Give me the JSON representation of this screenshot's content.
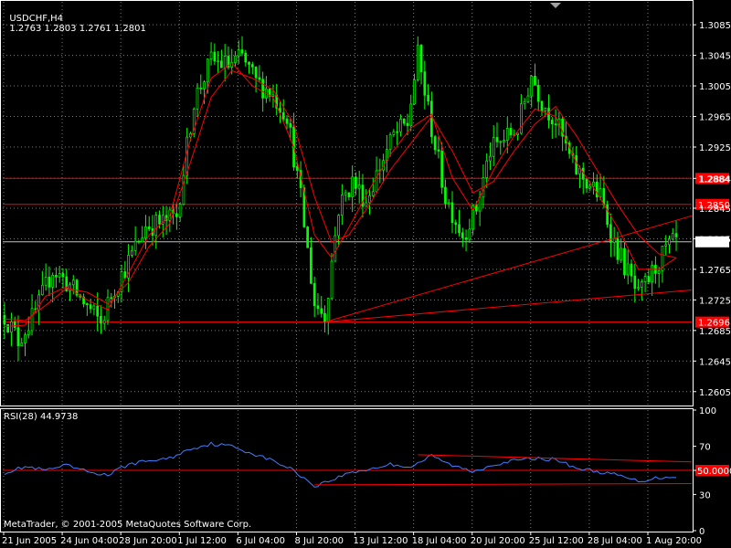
{
  "header": {
    "symbol": "USDCHF,H4",
    "ohlc": "1.2763 1.2803 1.2761 1.2801"
  },
  "rsi_label": "RSI(28) 44.9738",
  "copyright": "MetaTrader, © 2001-2005 MetaQuotes Software Corp.",
  "colors": {
    "background": "#000000",
    "grid": "#808080",
    "candles": "#00ff00",
    "indicator_lines": "#ff0000",
    "rsi": "#3f7fff",
    "text": "#ffffff"
  },
  "chart_data": [
    {
      "type": "candlestick",
      "title": "USDCHF,H4",
      "current_price": 1.2801,
      "ylim": [
        1.2588,
        1.3115
      ],
      "y_ticks": [
        "1.3085",
        "1.3045",
        "1.3005",
        "1.2965",
        "1.2925",
        "1.2884",
        "1.2845",
        "1.2805",
        "1.2765",
        "1.2725",
        "1.2685",
        "1.2645",
        "1.2605"
      ],
      "x_ticks": [
        "21 Jun 2005",
        "24 Jun 04:00",
        "28 Jun 20:00",
        "1 Jul 12:00",
        "6 Jul 04:00",
        "8 Jul 20:00",
        "13 Jul 12:00",
        "18 Jul 04:00",
        "20 Jul 20:00",
        "25 Jul 12:00",
        "28 Jul 04:00",
        "1 Aug 20:00"
      ],
      "price_path": [
        [
          0,
          1.2705
        ],
        [
          4,
          1.2672
        ],
        [
          9,
          1.2708
        ],
        [
          14,
          1.2765
        ],
        [
          18,
          1.2748
        ],
        [
          23,
          1.2722
        ],
        [
          28,
          1.2694
        ],
        [
          31,
          1.2732
        ],
        [
          36,
          1.2775
        ],
        [
          41,
          1.2822
        ],
        [
          46,
          1.2826
        ],
        [
          50,
          1.2835
        ],
        [
          55,
          1.2985
        ],
        [
          60,
          1.3038
        ],
        [
          65,
          1.3032
        ],
        [
          69,
          1.3042
        ],
        [
          73,
          1.301
        ],
        [
          77,
          1.2998
        ],
        [
          82,
          1.2968
        ],
        [
          86,
          1.2858
        ],
        [
          90,
          1.272
        ],
        [
          93,
          1.2705
        ],
        [
          97,
          1.2845
        ],
        [
          101,
          1.288
        ],
        [
          105,
          1.2855
        ],
        [
          109,
          1.29
        ],
        [
          113,
          1.294
        ],
        [
          117,
          1.2955
        ],
        [
          120,
          1.3045
        ],
        [
          124,
          1.295
        ],
        [
          128,
          1.286
        ],
        [
          133,
          1.281
        ],
        [
          137,
          1.2845
        ],
        [
          141,
          1.292
        ],
        [
          145,
          1.2935
        ],
        [
          149,
          1.295
        ],
        [
          153,
          1.302
        ],
        [
          156,
          1.2985
        ],
        [
          160,
          1.296
        ],
        [
          165,
          1.29
        ],
        [
          169,
          1.288
        ],
        [
          173,
          1.286
        ],
        [
          177,
          1.28
        ],
        [
          181,
          1.276
        ],
        [
          184,
          1.2728
        ],
        [
          188,
          1.276
        ],
        [
          192,
          1.279
        ],
        [
          195,
          1.2801
        ]
      ],
      "ma_fast": [
        [
          0,
          1.269
        ],
        [
          6,
          1.2692
        ],
        [
          12,
          1.273
        ],
        [
          18,
          1.2742
        ],
        [
          24,
          1.2725
        ],
        [
          30,
          1.2712
        ],
        [
          36,
          1.276
        ],
        [
          42,
          1.281
        ],
        [
          48,
          1.2835
        ],
        [
          54,
          1.2935
        ],
        [
          60,
          1.3015
        ],
        [
          66,
          1.3035
        ],
        [
          72,
          1.3005
        ],
        [
          78,
          1.299
        ],
        [
          84,
          1.2925
        ],
        [
          90,
          1.281
        ],
        [
          95,
          1.278
        ],
        [
          100,
          1.282
        ],
        [
          106,
          1.287
        ],
        [
          112,
          1.2915
        ],
        [
          118,
          1.295
        ],
        [
          124,
          1.2968
        ],
        [
          130,
          1.2885
        ],
        [
          136,
          1.2842
        ],
        [
          142,
          1.2895
        ],
        [
          148,
          1.294
        ],
        [
          154,
          1.2975
        ],
        [
          160,
          1.2965
        ],
        [
          166,
          1.2905
        ],
        [
          172,
          1.2865
        ],
        [
          178,
          1.282
        ],
        [
          184,
          1.2765
        ],
        [
          190,
          1.2765
        ],
        [
          195,
          1.278
        ]
      ],
      "ma_slow": [
        [
          0,
          1.27
        ],
        [
          6,
          1.2698
        ],
        [
          12,
          1.2718
        ],
        [
          18,
          1.274
        ],
        [
          24,
          1.2735
        ],
        [
          30,
          1.272
        ],
        [
          36,
          1.2748
        ],
        [
          42,
          1.2795
        ],
        [
          48,
          1.2825
        ],
        [
          54,
          1.2905
        ],
        [
          60,
          1.299
        ],
        [
          66,
          1.3025
        ],
        [
          72,
          1.3015
        ],
        [
          78,
          1.3
        ],
        [
          84,
          1.2955
        ],
        [
          90,
          1.286
        ],
        [
          95,
          1.28
        ],
        [
          100,
          1.281
        ],
        [
          106,
          1.285
        ],
        [
          112,
          1.2895
        ],
        [
          118,
          1.293
        ],
        [
          124,
          1.2965
        ],
        [
          130,
          1.292
        ],
        [
          136,
          1.2865
        ],
        [
          142,
          1.288
        ],
        [
          148,
          1.292
        ],
        [
          154,
          1.2955
        ],
        [
          160,
          1.2978
        ],
        [
          166,
          1.294
        ],
        [
          172,
          1.2895
        ],
        [
          178,
          1.285
        ],
        [
          184,
          1.281
        ],
        [
          190,
          1.2785
        ],
        [
          195,
          1.278
        ]
      ],
      "horizontal_levels": [
        {
          "price": 1.2884,
          "label": "1.2884"
        },
        {
          "price": 1.285,
          "label": "1.2850"
        },
        {
          "price": 1.2696,
          "label": "1.2696"
        }
      ],
      "trendlines": [
        {
          "from": [
            93,
            1.2696
          ],
          "to": [
            200,
            1.2835
          ]
        },
        {
          "from": [
            93,
            1.2696
          ],
          "to": [
            200,
            1.2738
          ]
        }
      ]
    },
    {
      "type": "line",
      "title": "RSI(28) 44.9738",
      "ylim": [
        0,
        100
      ],
      "y_ticks": [
        "100",
        "70",
        "50.0000",
        "30",
        "0"
      ],
      "level_label": "50.0000",
      "levels": [
        50
      ],
      "rsi": [
        [
          0,
          48
        ],
        [
          6,
          53
        ],
        [
          12,
          50
        ],
        [
          18,
          54
        ],
        [
          24,
          49
        ],
        [
          30,
          46
        ],
        [
          36,
          55
        ],
        [
          42,
          58
        ],
        [
          48,
          60
        ],
        [
          54,
          68
        ],
        [
          60,
          72
        ],
        [
          66,
          70
        ],
        [
          72,
          64
        ],
        [
          78,
          58
        ],
        [
          84,
          50
        ],
        [
          90,
          37
        ],
        [
          95,
          42
        ],
        [
          100,
          48
        ],
        [
          106,
          51
        ],
        [
          112,
          55
        ],
        [
          118,
          53
        ],
        [
          124,
          62
        ],
        [
          130,
          54
        ],
        [
          136,
          49
        ],
        [
          142,
          55
        ],
        [
          148,
          58
        ],
        [
          154,
          60
        ],
        [
          160,
          59
        ],
        [
          166,
          52
        ],
        [
          172,
          49
        ],
        [
          178,
          46
        ],
        [
          184,
          41
        ],
        [
          190,
          44
        ],
        [
          195,
          45
        ]
      ],
      "trendlines": [
        {
          "from": [
            120,
            63
          ],
          "to": [
            200,
            57
          ]
        },
        {
          "from": [
            90,
            38
          ],
          "to": [
            200,
            39
          ]
        }
      ]
    }
  ]
}
